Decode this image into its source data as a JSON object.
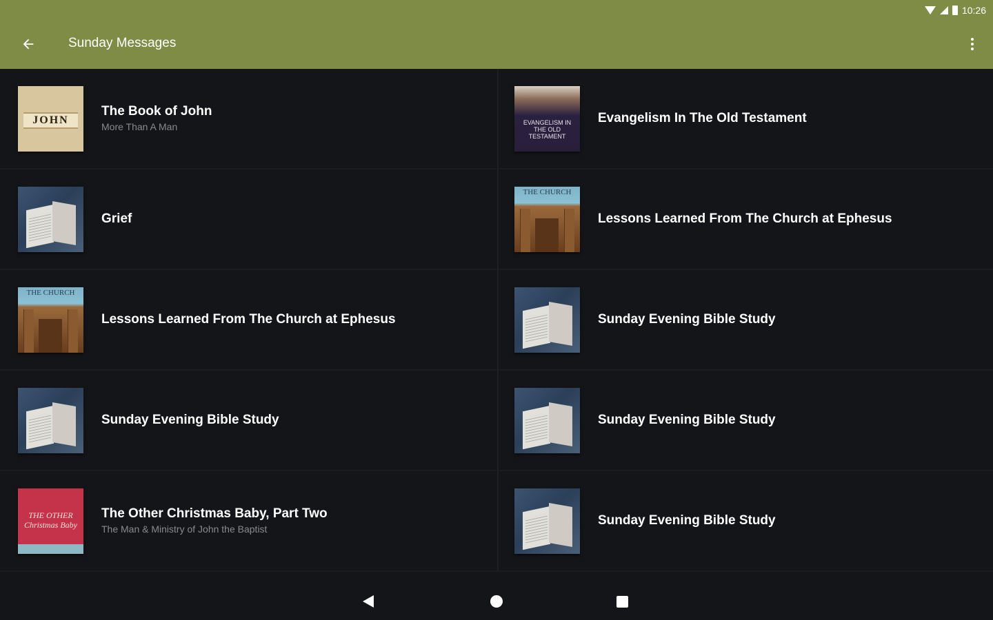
{
  "status_bar": {
    "time": "10:26"
  },
  "app_bar": {
    "title": "Sunday Messages"
  },
  "items": [
    {
      "title": "The Book of John",
      "subtitle": "More Than A Man",
      "thumb": "john",
      "thumb_text": "JOHN"
    },
    {
      "title": "Evangelism In The Old Testament",
      "subtitle": "",
      "thumb": "evangelism",
      "thumb_text": "EVANGELISM IN THE OLD TESTAMENT"
    },
    {
      "title": "Grief",
      "subtitle": "",
      "thumb": "bible"
    },
    {
      "title": "Lessons Learned From The Church at Ephesus",
      "subtitle": "",
      "thumb": "church",
      "thumb_text": "THE CHURCH"
    },
    {
      "title": "Lessons Learned From The Church at Ephesus",
      "subtitle": "",
      "thumb": "church",
      "thumb_text": "THE CHURCH"
    },
    {
      "title": "Sunday Evening Bible Study",
      "subtitle": "",
      "thumb": "bible"
    },
    {
      "title": "Sunday Evening Bible Study",
      "subtitle": "",
      "thumb": "bible"
    },
    {
      "title": "Sunday Evening Bible Study",
      "subtitle": "",
      "thumb": "bible"
    },
    {
      "title": "The Other Christmas Baby, Part Two",
      "subtitle": "The Man & Ministry of John the Baptist",
      "thumb": "christmas",
      "thumb_text": "THE OTHER Christmas Baby"
    },
    {
      "title": "Sunday Evening Bible Study",
      "subtitle": "",
      "thumb": "bible"
    }
  ],
  "colors": {
    "app_bar": "#7e8c45",
    "background": "#141518"
  }
}
